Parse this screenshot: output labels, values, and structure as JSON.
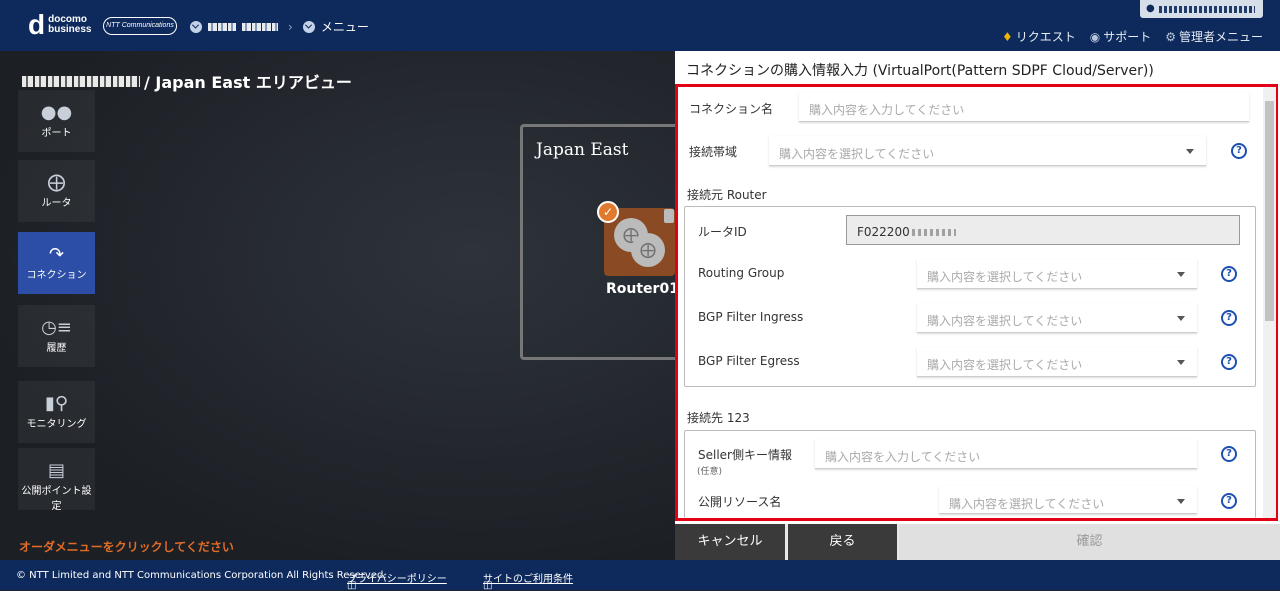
{
  "header": {
    "logo_line1": "docomo",
    "logo_line2": "business",
    "ntt_logo": "NTT Communications",
    "breadcrumb_menu": "メニュー",
    "nav": [
      {
        "label": "リクエスト",
        "icon": "bell-icon"
      },
      {
        "label": "サポート",
        "icon": "help-circle-icon"
      },
      {
        "label": "管理者メニュー",
        "icon": "gear-icon"
      }
    ]
  },
  "area_title": "/ Japan East エリアビュー",
  "sidebar": [
    {
      "label": "ポート",
      "icon": "port-icon"
    },
    {
      "label": "ルータ",
      "icon": "router-icon"
    },
    {
      "label": "コネクション",
      "icon": "connection-icon"
    },
    {
      "label": "履歴",
      "icon": "history-icon"
    },
    {
      "label": "モニタリング",
      "icon": "monitoring-icon"
    },
    {
      "label": "公開ポイント設定",
      "icon": "public-point-icon"
    }
  ],
  "order_hint": "オーダメニューをクリックしてください",
  "diagram": {
    "region_name": "Japan East",
    "router_name": "Router01"
  },
  "panel": {
    "title": "コネクションの購入情報入力 (VirtualPort(Pattern SDPF Cloud/Server))",
    "connection_name_label": "コネクション名",
    "connection_name_placeholder": "購入内容を入力してください",
    "bandwidth_label": "接続帯域",
    "bandwidth_placeholder": "購入内容を選択してください",
    "source_section": "接続元 Router",
    "router_id_label": "ルータID",
    "router_id_value": "F022200",
    "routing_group_label": "Routing Group",
    "routing_group_placeholder": "購入内容を選択してください",
    "bgp_ingress_label": "BGP Filter Ingress",
    "bgp_ingress_placeholder": "購入内容を選択してください",
    "bgp_egress_label": "BGP Filter Egress",
    "bgp_egress_placeholder": "購入内容を選択してください",
    "dest_section": "接続先 123",
    "seller_key_label": "Seller側キー情報",
    "seller_key_optional": "(任意)",
    "seller_key_placeholder": "購入内容を入力してください",
    "public_resource_label": "公開リソース名",
    "public_resource_placeholder": "購入内容を選択してください",
    "help_glyph": "?"
  },
  "buttons": {
    "cancel": "キャンセル",
    "back": "戻る",
    "confirm": "確認"
  },
  "footer": {
    "copyright": "© NTT Limited and NTT Communications Corporation All Rights Reserved.",
    "privacy": "プライバシーポリシー",
    "terms": "サイトのご利用条件"
  }
}
